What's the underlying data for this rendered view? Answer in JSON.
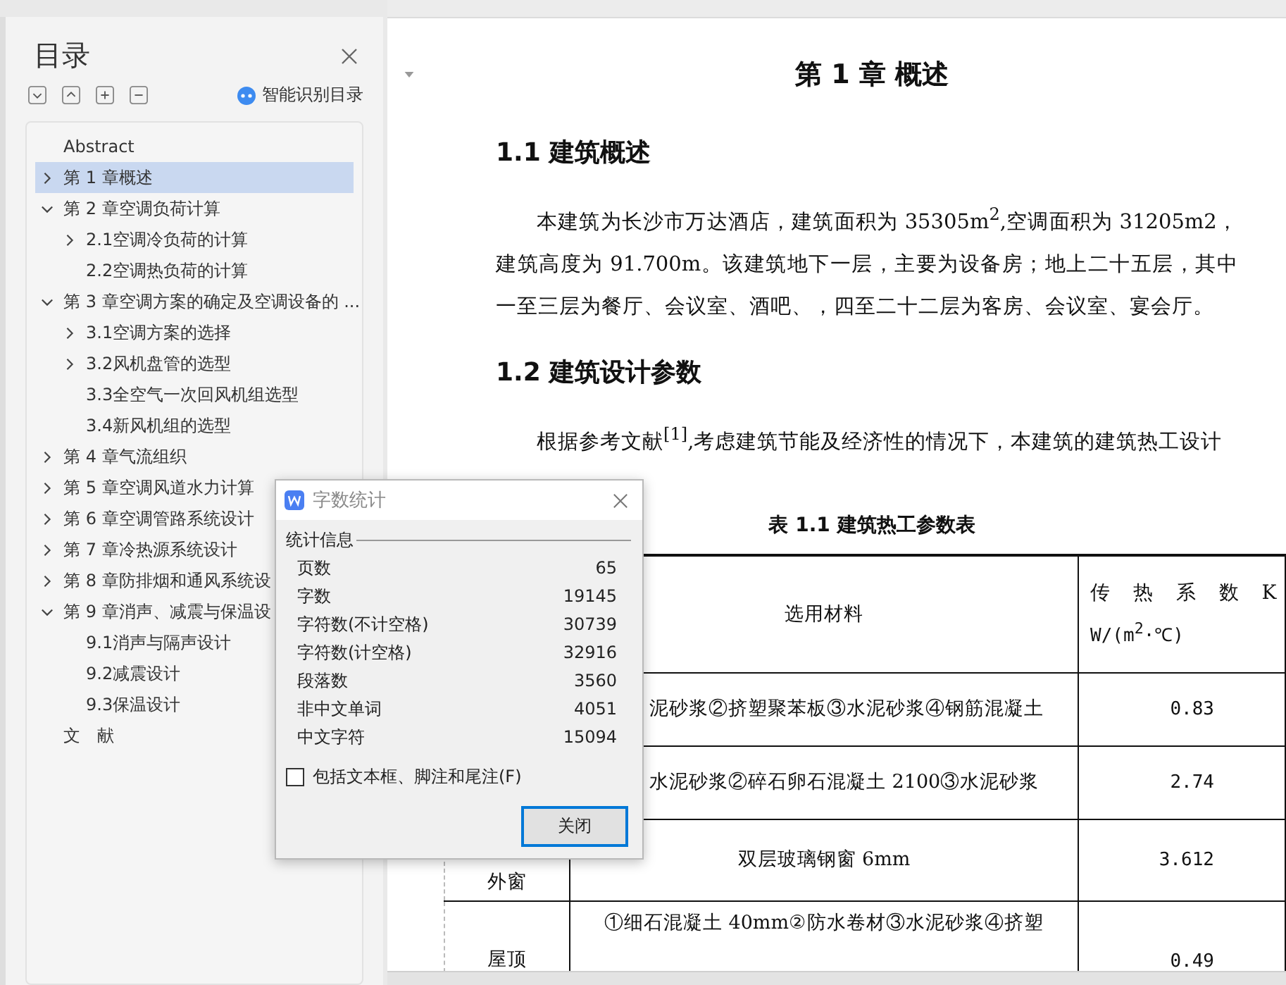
{
  "toc": {
    "title": "目录",
    "smart_button": "智能识别目录",
    "items": [
      {
        "label": "Abstract",
        "kind": "leaf",
        "selected": false
      },
      {
        "label": "第 1 章概述",
        "kind": "branch",
        "expanded": false,
        "selected": true
      },
      {
        "label": "第 2 章空调负荷计算",
        "kind": "branch",
        "expanded": true,
        "selected": false,
        "children": [
          {
            "label": "2.1空调冷负荷的计算",
            "kind": "branch",
            "expanded": false,
            "selected": false
          },
          {
            "label": "2.2空调热负荷的计算",
            "kind": "leaf",
            "selected": false
          }
        ]
      },
      {
        "label": "第 3 章空调方案的确定及空调设备的 ...",
        "kind": "branch",
        "expanded": true,
        "selected": false,
        "children": [
          {
            "label": "3.1空调方案的选择",
            "kind": "branch",
            "expanded": false,
            "selected": false
          },
          {
            "label": "3.2风机盘管的选型",
            "kind": "branch",
            "expanded": false,
            "selected": false
          },
          {
            "label": "3.3全空气一次回风机组选型",
            "kind": "leaf",
            "selected": false
          },
          {
            "label": "3.4新风机组的选型",
            "kind": "leaf",
            "selected": false
          }
        ]
      },
      {
        "label": "第 4 章气流组织",
        "kind": "branch",
        "expanded": false,
        "selected": false
      },
      {
        "label": "第 5 章空调风道水力计算",
        "kind": "branch",
        "expanded": false,
        "selected": false
      },
      {
        "label": "第 6 章空调管路系统设计",
        "kind": "branch",
        "expanded": false,
        "selected": false
      },
      {
        "label": "第 7 章冷热源系统设计",
        "kind": "branch",
        "expanded": false,
        "selected": false
      },
      {
        "label": "第 8 章防排烟和通风系统设",
        "kind": "branch",
        "expanded": false,
        "selected": false
      },
      {
        "label": "第 9 章消声、减震与保温设",
        "kind": "branch",
        "expanded": true,
        "selected": false,
        "children": [
          {
            "label": "9.1消声与隔声设计",
            "kind": "leaf",
            "selected": false
          },
          {
            "label": "9.2减震设计",
            "kind": "leaf",
            "selected": false
          },
          {
            "label": "9.3保温设计",
            "kind": "leaf",
            "selected": false
          }
        ]
      },
      {
        "label": "文　献",
        "kind": "leaf",
        "selected": false
      }
    ]
  },
  "document": {
    "chapter_title": "第 1 章  概述",
    "sections": [
      {
        "heading": "1.1  建筑概述",
        "paragraphs": [
          "本建筑为长沙市万达酒店，建筑面积为 35305m$^{2}$,空调面积为 31205m2，建筑高度为 91.700m。该建筑地下一层，主要为设备房；地上二十五层，其中一至三层为餐厅、会议室、酒吧、，四至二十二层为客房、会议室、宴会厅。"
        ]
      },
      {
        "heading": "1.2  建筑设计参数",
        "paragraphs": [
          "根据参考文献$^{[1]}$,考虑建筑节能及经济性的情况下，本建筑的建筑热工设计"
        ]
      }
    ],
    "table": {
      "caption": "表 1.1  建筑热工参数表",
      "header": {
        "column_2": "选用材料",
        "column_3": [
          "传 热 系 数 K",
          "W/(m$^{2}$·℃)"
        ]
      },
      "rows": [
        {
          "column_2": "泥砂浆②挤塑聚苯板③水泥砂浆④钢筋混凝土",
          "column_3": "0.83"
        },
        {
          "column_2": "水泥砂浆②碎石卵石混凝土 2100③水泥砂浆",
          "column_3": "2.74"
        },
        {
          "column_1": "外窗",
          "column_2": "双层玻璃钢窗 6mm",
          "column_3": "3.612"
        },
        {
          "column_1": "屋顶",
          "column_2": "①细石混凝土 40mm②防水卷材③水泥砂浆④挤塑",
          "column_3": "0.49"
        }
      ]
    }
  },
  "dialog": {
    "title": "字数统计",
    "group": "统计信息",
    "stats": [
      {
        "label": "页数",
        "value": "65"
      },
      {
        "label": "字数",
        "value": "19145"
      },
      {
        "label": "字符数(不计空格)",
        "value": "30739"
      },
      {
        "label": "字符数(计空格)",
        "value": "32916"
      },
      {
        "label": "段落数",
        "value": "3560"
      },
      {
        "label": "非中文单词",
        "value": "4051"
      },
      {
        "label": "中文字符",
        "value": "15094"
      }
    ],
    "checkbox": {
      "label": "包括文本框、脚注和尾注(F)",
      "checked": false
    },
    "button": "关闭"
  }
}
